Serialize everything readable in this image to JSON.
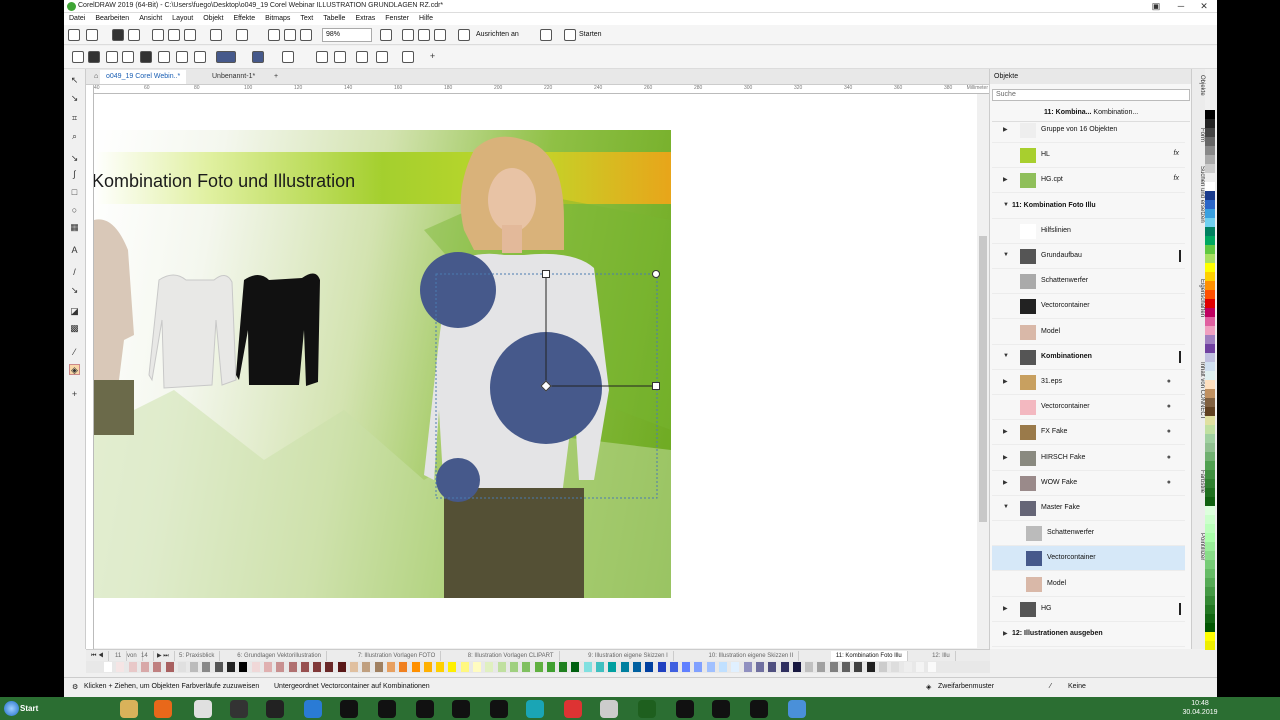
{
  "window": {
    "title": "CorelDRAW 2019 (64-Bit) - C:\\Users\\fuego\\Desktop\\o049_19 Corel Webinar ILLUSTRATION GRUNDLAGEN RZ.cdr*"
  },
  "menu": [
    "Datei",
    "Bearbeiten",
    "Ansicht",
    "Layout",
    "Objekt",
    "Effekte",
    "Bitmaps",
    "Text",
    "Tabelle",
    "Extras",
    "Fenster",
    "Hilfe"
  ],
  "toolbar": {
    "zoom": "98%",
    "snap_label": "Ausrichten an",
    "start_label": "Starten"
  },
  "doc_tabs": [
    "o049_19 Corel Webin..*",
    "Unbenannt-1*"
  ],
  "ruler": {
    "labels": [
      "40",
      "60",
      "80",
      "100",
      "120",
      "140",
      "160",
      "180",
      "200",
      "220",
      "240",
      "260",
      "280",
      "300",
      "320",
      "340",
      "360",
      "380"
    ],
    "unit": "Millimeter"
  },
  "artboard": {
    "banner_title": "Kombination Foto und Illustration"
  },
  "docker": {
    "title": "Objekte",
    "search_placeholder": "Suche",
    "path_label": "11: Kombina...",
    "path_detail": "Kombination...",
    "rows": [
      {
        "label": "Gruppe von 16 Objekten",
        "kind": "object",
        "arrow": "▶"
      },
      {
        "label": "HL",
        "kind": "object",
        "arrow": "",
        "fx": "fx"
      },
      {
        "label": "HG.cpt",
        "kind": "object",
        "arrow": "▶",
        "fx": "fx"
      },
      {
        "label": "11: Kombination Foto Illu",
        "kind": "layer",
        "arrow": "▼"
      },
      {
        "label": "Hilfslinien",
        "kind": "object",
        "arrow": ""
      },
      {
        "label": "Grundaufbau",
        "kind": "group",
        "arrow": "▼"
      },
      {
        "label": "Schattenwerfer",
        "kind": "object",
        "arrow": ""
      },
      {
        "label": "Vectorcontainer",
        "kind": "object",
        "arrow": ""
      },
      {
        "label": "Model",
        "kind": "object",
        "arrow": ""
      },
      {
        "label": "Kombinationen",
        "kind": "group-bold",
        "arrow": "▼"
      },
      {
        "label": "31.eps",
        "kind": "object",
        "arrow": "▶",
        "eye": "●"
      },
      {
        "label": "Vectorcontainer",
        "kind": "object",
        "arrow": "",
        "eye": "●"
      },
      {
        "label": "FX Fake",
        "kind": "object",
        "arrow": "▶",
        "eye": "●"
      },
      {
        "label": "HIRSCH Fake",
        "kind": "object",
        "arrow": "▶",
        "eye": "●"
      },
      {
        "label": "WOW Fake",
        "kind": "object",
        "arrow": "▶",
        "eye": "●"
      },
      {
        "label": "Master Fake",
        "kind": "object",
        "arrow": "▼"
      },
      {
        "label": "Schattenwerfer",
        "kind": "child",
        "arrow": ""
      },
      {
        "label": "Vectorcontainer",
        "kind": "child-selected",
        "arrow": ""
      },
      {
        "label": "Model",
        "kind": "child",
        "arrow": ""
      },
      {
        "label": "HG",
        "kind": "group",
        "arrow": "▶"
      },
      {
        "label": "12: Illustrationen ausgeben",
        "kind": "layer",
        "arrow": "▶"
      }
    ]
  },
  "side_tabs": [
    "Objekte",
    "Form",
    "Suchen und ersetzen",
    "Eigenschaften",
    "Inhalt von CONNECT",
    "Farbstile",
    "Pointillizer"
  ],
  "page_tabs": [
    "5: Praxisblick",
    "6: Grundlagen Vektorillustration",
    "7: Illustration Vorlagen FOTO",
    "8: Illustration Vorlagen CLIPART",
    "9: Illustration eigene Skizzen I",
    "10: Illustration eigene Skizzen II",
    "11: Kombination Foto Illu",
    "12: Illu"
  ],
  "page_nav": {
    "current": "11",
    "of": "von",
    "total": "14"
  },
  "status": {
    "hint": "Klicken + Ziehen, um Objekten Farbverläufe zuzuweisen",
    "selection": "Untergeordnet Vectorcontainer auf Kombinationen",
    "fill": "Zweifarbenmuster",
    "outline": "Keine"
  },
  "taskbar": {
    "start": "Start",
    "time": "10:48",
    "date": "30.04.2019"
  },
  "colors": {
    "accent": "#1a5fb4",
    "selection": "#d6e8f8",
    "sweater_dots": "#46598b",
    "taskbar": "#2b6e32"
  }
}
